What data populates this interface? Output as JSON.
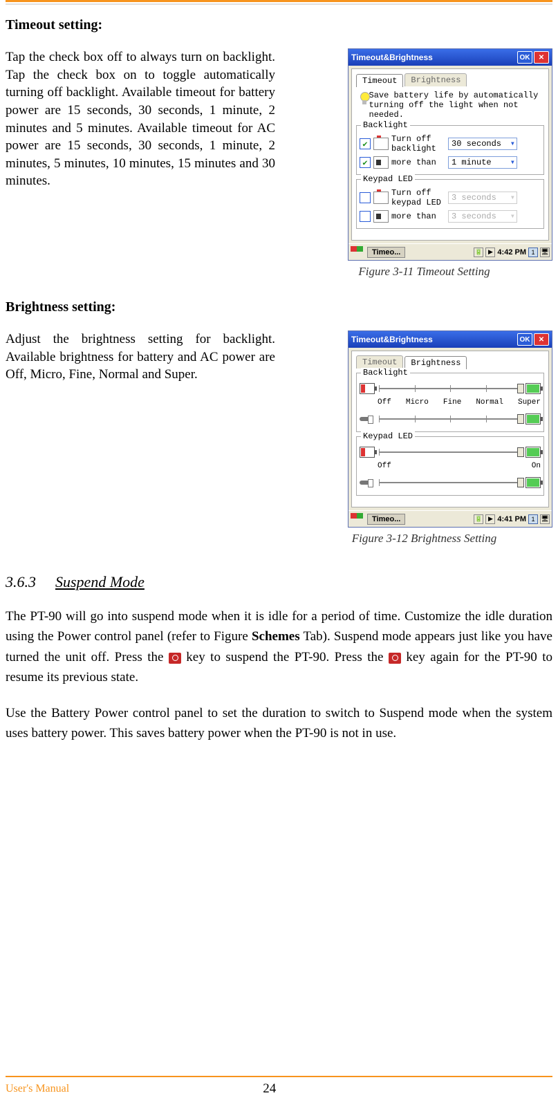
{
  "top": {
    "heading1": "Timeout setting:",
    "para1": "Tap the check box off to always turn on backlight. Tap the check box on to toggle automatically turning off backlight. Available timeout for battery power are 15 seconds, 30 seconds, 1 minute, 2 minutes and 5 minutes. Available timeout for AC power are 15 seconds, 30 seconds, 1 minute, 2 minutes, 5 minutes, 10 minutes, 15 minutes and 30 minutes.",
    "heading2": "Brightness setting:",
    "para2": "Adjust the brightness setting for backlight. Available brightness for battery and AC power are Off, Micro, Fine, Normal and Super."
  },
  "fig1": {
    "caption": "Figure 3-11 Timeout Setting",
    "win_title": "Timeout&Brightness",
    "ok": "OK",
    "tab_timeout": "Timeout",
    "tab_brightness": "Brightness",
    "hint": "Save battery life by automatically turning off the light when not needed.",
    "group_backlight": "Backlight",
    "backlight_l1": "Turn off",
    "backlight_l2": "backlight",
    "backlight_l3": "more than",
    "backlight_val1": "30 seconds",
    "backlight_val2": "1 minute",
    "group_keypad": "Keypad LED",
    "keypad_l1": "Turn off",
    "keypad_l2": "keypad LED",
    "keypad_l3": "more than",
    "keypad_val1": "3 seconds",
    "keypad_val2": "3 seconds",
    "task_app": "Timeo...",
    "time": "4:42 PM",
    "tray_num": "1"
  },
  "fig2": {
    "caption": "Figure 3-12 Brightness Setting",
    "win_title": "Timeout&Brightness",
    "ok": "OK",
    "tab_timeout": "Timeout",
    "tab_brightness": "Brightness",
    "group_backlight": "Backlight",
    "labels": {
      "off": "Off",
      "micro": "Micro",
      "fine": "Fine",
      "normal": "Normal",
      "super": "Super",
      "on": "On"
    },
    "group_keypad": "Keypad LED",
    "task_app": "Timeo...",
    "time": "4:41 PM",
    "tray_num": "1"
  },
  "subsection": {
    "num": "3.6.3",
    "title": "Suspend Mode"
  },
  "body": {
    "p1a": "The PT-90 will go into suspend mode when it is idle for a period of time. Customize the idle duration using the Power control panel (refer to Figure ",
    "p1b": "Schemes",
    "p1c": " Tab). Suspend mode appears just like you have turned the unit off. Press the ",
    "p1d": " key to suspend the PT-90. Press the ",
    "p1e": " key again for the PT-90 to resume its previous state.",
    "p2": "Use the Battery Power control panel to set the duration to switch to Suspend mode when the system uses battery power. This saves battery power when the PT-90 is not in use."
  },
  "footer": {
    "label": "User's Manual",
    "page": "24"
  }
}
